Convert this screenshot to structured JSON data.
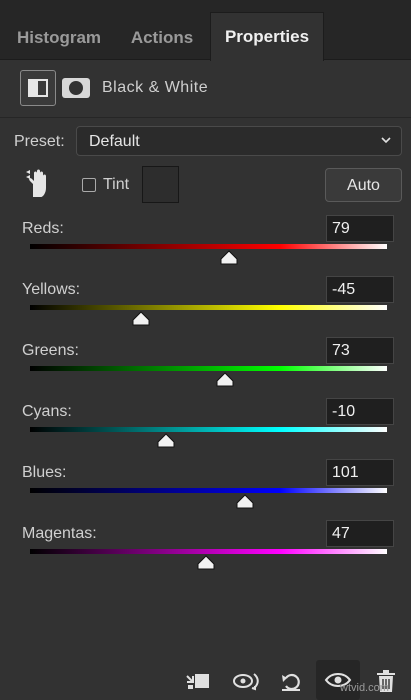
{
  "tabs": [
    {
      "label": "Histogram"
    },
    {
      "label": "Actions"
    },
    {
      "label": "Properties"
    }
  ],
  "adjustment": {
    "title": "Black & White",
    "icon": "black-white-adjustment-icon",
    "mask_icon": "mask-icon"
  },
  "preset": {
    "label": "Preset:",
    "value": "Default"
  },
  "tint": {
    "label": "Tint",
    "checked": false
  },
  "auto_button": {
    "label": "Auto"
  },
  "sliders": [
    {
      "label": "Reds:",
      "value": "79",
      "level": 79,
      "gradient": [
        "#000000",
        "#ff0000",
        "#ffffff"
      ]
    },
    {
      "label": "Yellows:",
      "value": "-45",
      "level": -45,
      "gradient": [
        "#000000",
        "#ffff00",
        "#ffffff"
      ]
    },
    {
      "label": "Greens:",
      "value": "73",
      "level": 73,
      "gradient": [
        "#000000",
        "#00ff00",
        "#ffffff"
      ]
    },
    {
      "label": "Cyans:",
      "value": "-10",
      "level": -10,
      "gradient": [
        "#000000",
        "#00ffff",
        "#ffffff"
      ]
    },
    {
      "label": "Blues:",
      "value": "101",
      "level": 101,
      "gradient": [
        "#000000",
        "#0000ff",
        "#ffffff"
      ]
    },
    {
      "label": "Magentas:",
      "value": "47",
      "level": 47,
      "gradient": [
        "#000000",
        "#ff00ff",
        "#ffffff"
      ]
    }
  ],
  "slider_range": [
    -200,
    300
  ],
  "bottom_icons": [
    "clip-to-layer-icon",
    "view-previous-state-icon",
    "reset-icon",
    "visibility-eye-icon",
    "trash-icon"
  ],
  "watermark": "wtvid.com"
}
